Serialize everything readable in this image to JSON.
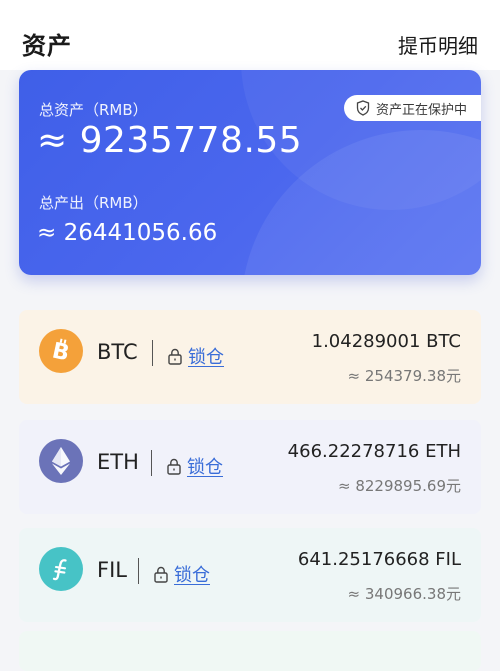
{
  "header": {
    "title": "资产",
    "detail_link": "提币明细"
  },
  "summary": {
    "protect_badge": "资产正在保护中",
    "total_label": "总资产（RMB）",
    "total_value": "≈ 9235778.55",
    "output_label": "总产出（RMB）",
    "output_value": "≈ 26441056.66",
    "card_color": "#4361ec"
  },
  "coins": [
    {
      "symbol": "BTC",
      "lock_label": "锁仓",
      "amount": "1.04289001 BTC",
      "fiat": "≈ 254379.38元",
      "icon": "bitcoin-icon",
      "icon_color": "#f4a13a",
      "row_color": "#fbf3e7"
    },
    {
      "symbol": "ETH",
      "lock_label": "锁仓",
      "amount": "466.22278716 ETH",
      "fiat": "≈ 8229895.69元",
      "icon": "ethereum-icon",
      "icon_color": "#6b73b8",
      "row_color": "#f1f2fa"
    },
    {
      "symbol": "FIL",
      "lock_label": "锁仓",
      "amount": "641.25176668 FIL",
      "fiat": "≈ 340966.38元",
      "icon": "filecoin-icon",
      "icon_color": "#47c3c6",
      "row_color": "#eef6f6"
    }
  ],
  "colors": {
    "link_blue": "#3a6dd8"
  }
}
